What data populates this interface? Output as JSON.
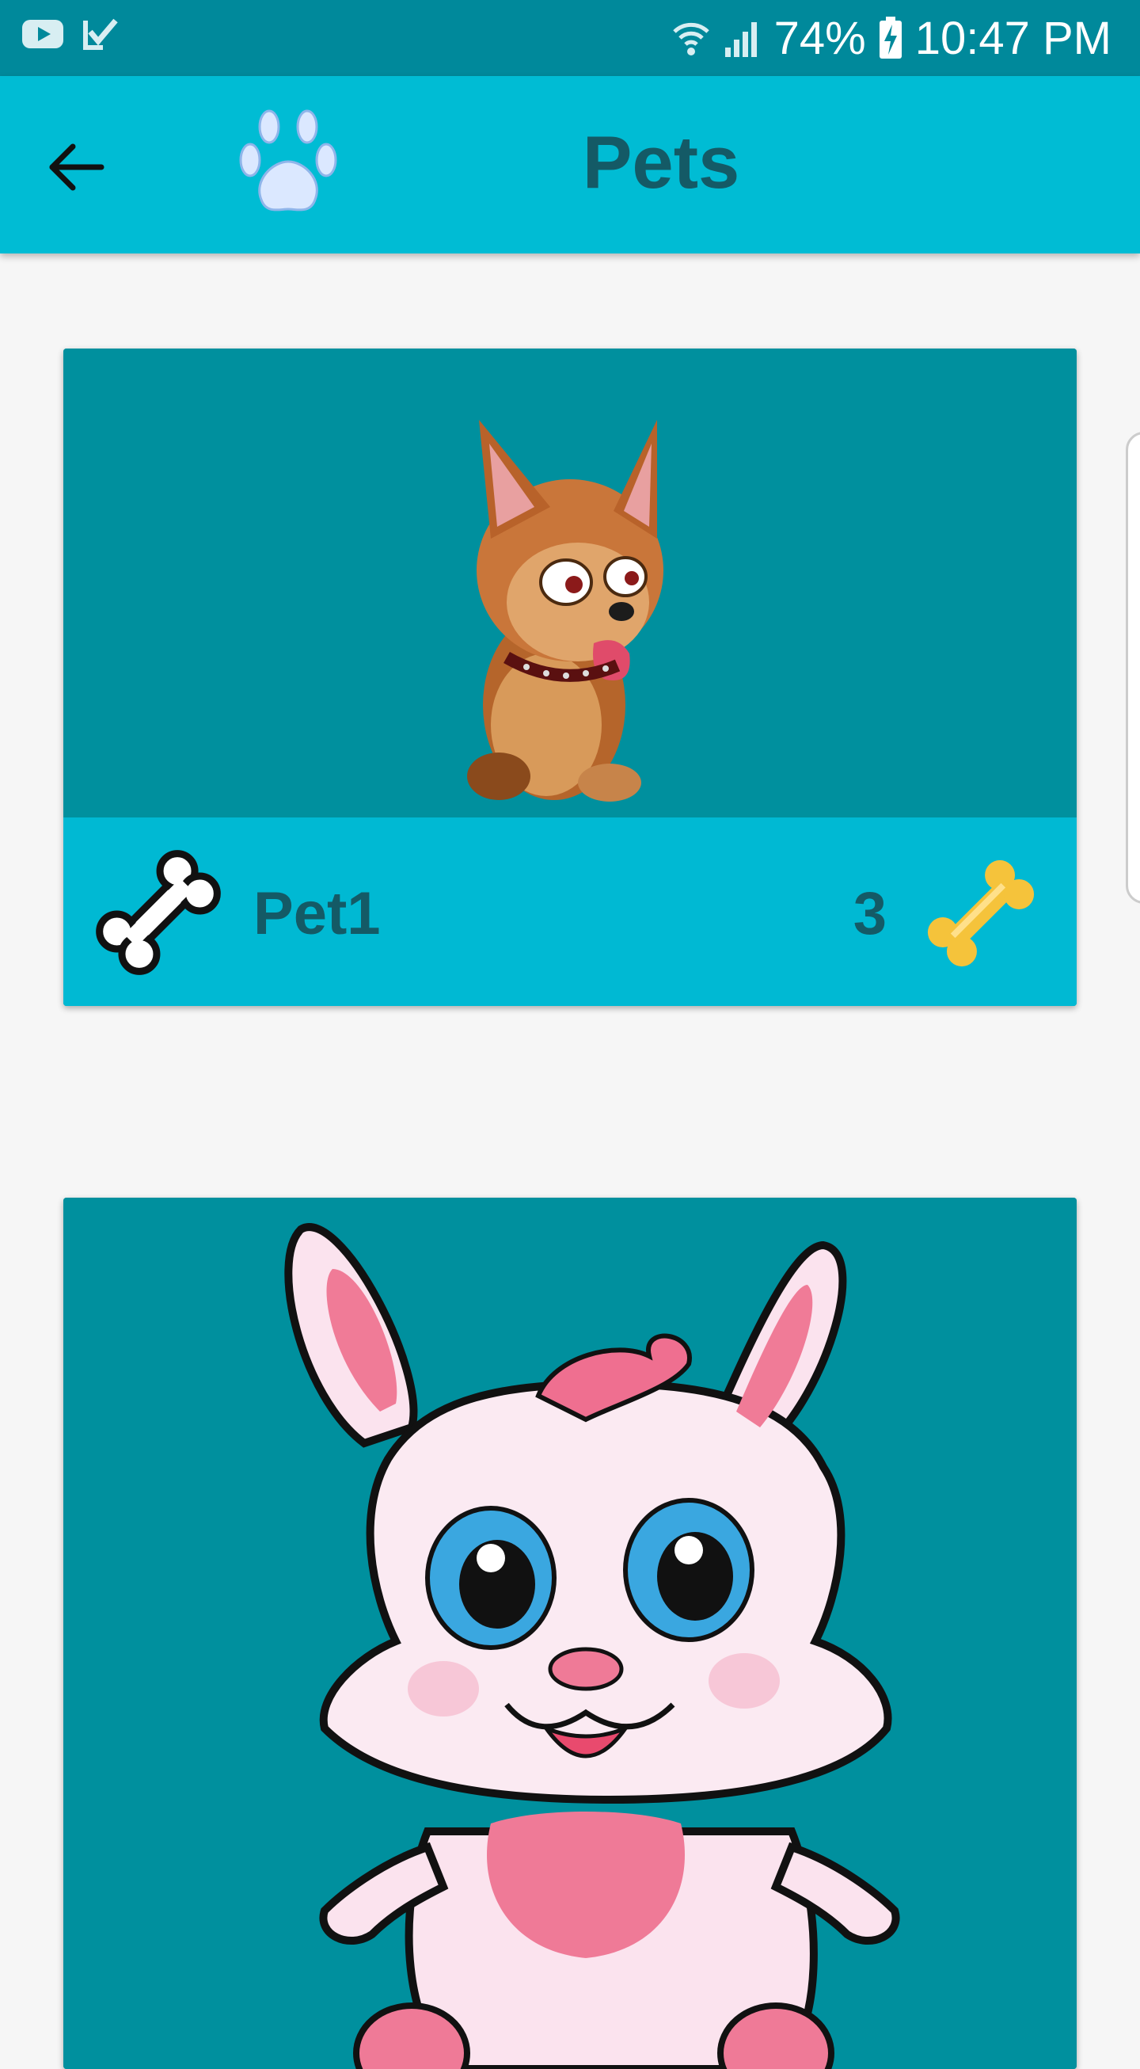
{
  "status_bar": {
    "battery": "74%",
    "time": "10:47 PM",
    "icons": [
      "youtube-icon",
      "check-icon",
      "wifi-icon",
      "signal-icon",
      "battery-charging-icon"
    ]
  },
  "app_bar": {
    "title": "Pets",
    "back_icon": "arrow-back-icon",
    "logo_icon": "paw-icon"
  },
  "pets": [
    {
      "name": "Pet1",
      "count": "3",
      "image": "cartoon-dog"
    },
    {
      "name": "",
      "count": "",
      "image": "cartoon-bunny"
    }
  ],
  "colors": {
    "status_bar": "#00899b",
    "app_bar": "#00bcd4",
    "card_image_bg": "#00909e",
    "card_footer_bg": "#00b9d3",
    "title_text": "#145a66",
    "bone_gold": "#f5c33b"
  }
}
